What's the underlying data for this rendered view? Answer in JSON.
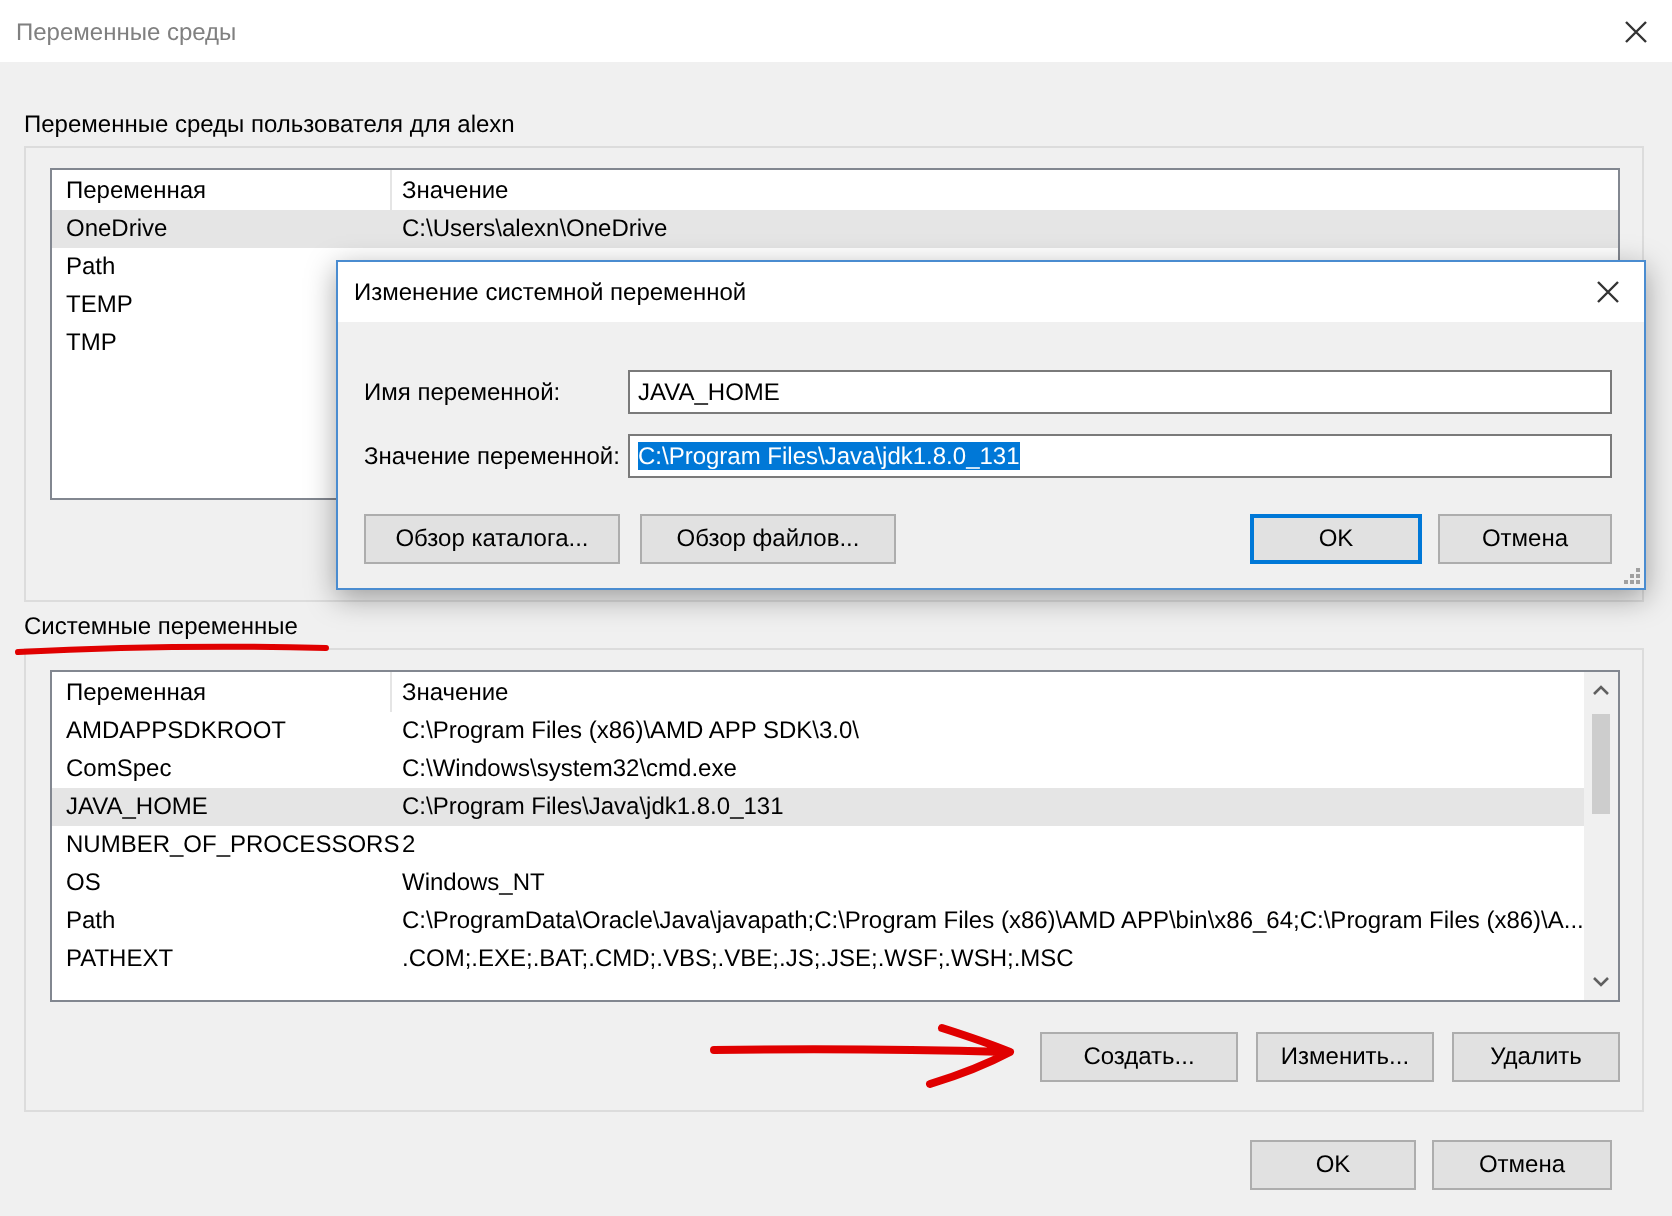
{
  "window": {
    "title": "Переменные среды"
  },
  "user_vars": {
    "title": "Переменные среды пользователя для alexn",
    "columns": [
      "Переменная",
      "Значение"
    ],
    "rows": [
      {
        "name": "OneDrive",
        "value": "C:\\Users\\alexn\\OneDrive",
        "selected": true
      },
      {
        "name": "Path",
        "value": "",
        "selected": false
      },
      {
        "name": "TEMP",
        "value": "",
        "selected": false
      },
      {
        "name": "TMP",
        "value": "",
        "selected": false
      }
    ]
  },
  "dialog": {
    "title": "Изменение системной переменной",
    "fields": [
      {
        "label": "Имя переменной:",
        "value": "JAVA_HOME",
        "selected": false
      },
      {
        "label": "Значение переменной:",
        "value": "C:\\Program Files\\Java\\jdk1.8.0_131",
        "selected": true
      }
    ],
    "left_buttons": [
      "Обзор каталога...",
      "Обзор файлов..."
    ],
    "buttons": [
      {
        "label": "OK",
        "default": true
      },
      {
        "label": "Отмена",
        "default": false
      }
    ]
  },
  "system_vars": {
    "title": "Системные переменные",
    "columns": [
      "Переменная",
      "Значение"
    ],
    "rows": [
      {
        "name": "AMDAPPSDKROOT",
        "value": "C:\\Program Files (x86)\\AMD APP SDK\\3.0\\",
        "selected": false
      },
      {
        "name": "ComSpec",
        "value": "C:\\Windows\\system32\\cmd.exe",
        "selected": false
      },
      {
        "name": "JAVA_HOME",
        "value": "C:\\Program Files\\Java\\jdk1.8.0_131",
        "selected": true
      },
      {
        "name": "NUMBER_OF_PROCESSORS",
        "value": "2",
        "selected": false
      },
      {
        "name": "OS",
        "value": "Windows_NT",
        "selected": false
      },
      {
        "name": "Path",
        "value": "C:\\ProgramData\\Oracle\\Java\\javapath;C:\\Program Files (x86)\\AMD APP\\bin\\x86_64;C:\\Program Files (x86)\\A...",
        "selected": false
      },
      {
        "name": "PATHEXT",
        "value": ".COM;.EXE;.BAT;.CMD;.VBS;.VBE;.JS;.JSE;.WSF;.WSH;.MSC",
        "selected": false
      }
    ],
    "buttons": [
      "Создать...",
      "Изменить...",
      "Удалить"
    ]
  },
  "footer_buttons": [
    {
      "label": "OK",
      "default": false
    },
    {
      "label": "Отмена",
      "default": false
    }
  ]
}
